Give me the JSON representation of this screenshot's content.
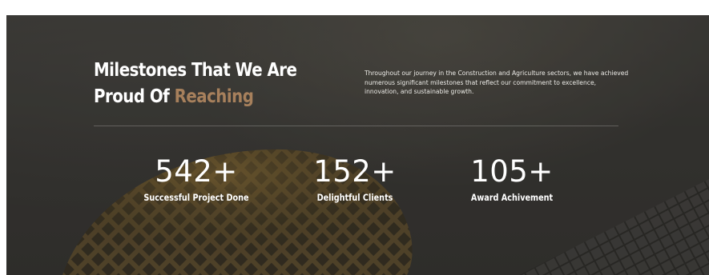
{
  "milestones": {
    "heading_main": "Milestones That We Are Proud Of",
    "heading_accent": "Reaching",
    "intro": "Throughout our journey in the Construction and Agriculture sectors, we have achieved numerous significant milestones that reflect our commitment to excellence, innovation, and sustainable growth.",
    "stats": [
      {
        "value": "542+",
        "label": "Successful Project Done"
      },
      {
        "value": "152+",
        "label": "Delightful Clients"
      },
      {
        "value": "105+",
        "label": "Award Achivement"
      }
    ],
    "colors": {
      "accent": "#a7805c",
      "background": "#3f3d39",
      "text": "#ffffff"
    }
  }
}
